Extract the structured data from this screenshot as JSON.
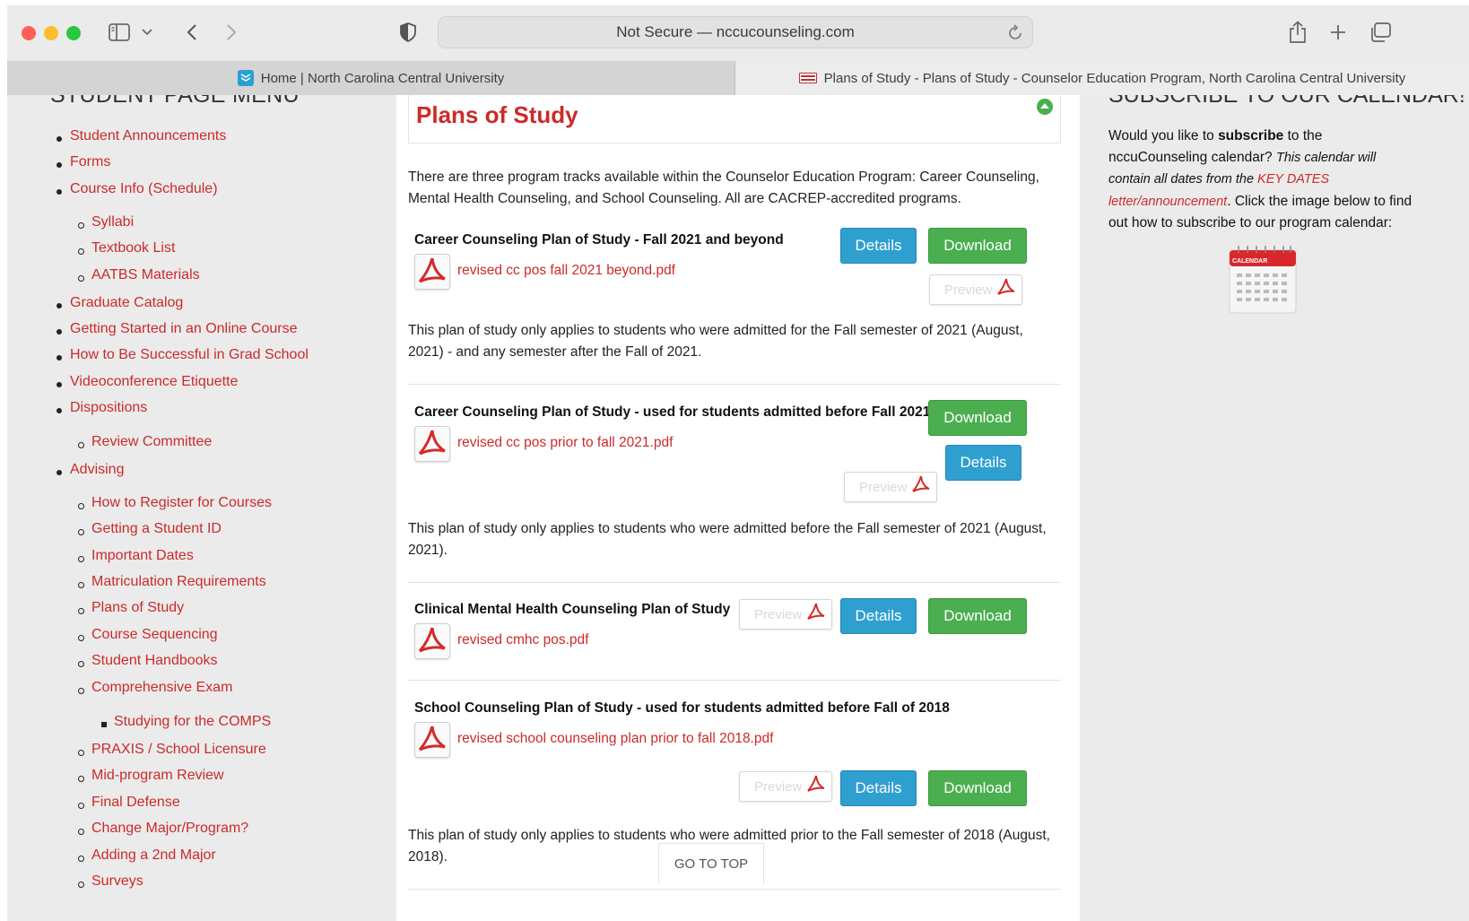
{
  "browser": {
    "address": "Not Secure — nccucounseling.com",
    "tabs": [
      {
        "label": "Home | North Carolina Central University"
      },
      {
        "label": "Plans of Study - Plans of Study - Counselor Education Program, North Carolina Central University"
      }
    ]
  },
  "sidebar": {
    "heading": "STUDENT PAGE MENU",
    "items": [
      {
        "label": "Student Announcements"
      },
      {
        "label": "Forms"
      },
      {
        "label": "Course Info (Schedule)"
      },
      {
        "label": "Syllabi"
      },
      {
        "label": "Textbook List"
      },
      {
        "label": "AATBS Materials"
      },
      {
        "label": "Graduate Catalog"
      },
      {
        "label": "Getting Started in an Online Course"
      },
      {
        "label": "How to Be Successful in Grad School"
      },
      {
        "label": "Videoconference Etiquette"
      },
      {
        "label": "Dispositions"
      },
      {
        "label": "Review Committee"
      },
      {
        "label": "Advising"
      },
      {
        "label": "How to Register for Courses"
      },
      {
        "label": "Getting a Student ID"
      },
      {
        "label": "Important Dates"
      },
      {
        "label": "Matriculation Requirements"
      },
      {
        "label": "Plans of Study"
      },
      {
        "label": "Course Sequencing"
      },
      {
        "label": "Student Handbooks"
      },
      {
        "label": "Comprehensive Exam"
      },
      {
        "label": "Studying for the COMPS"
      },
      {
        "label": "PRAXIS / School Licensure"
      },
      {
        "label": "Mid-program Review"
      },
      {
        "label": "Final Defense"
      },
      {
        "label": "Change Major/Program?"
      },
      {
        "label": "Adding a 2nd Major"
      },
      {
        "label": "Surveys"
      }
    ]
  },
  "main": {
    "title": "Plans of Study",
    "intro": "There are three program tracks available within the Counselor Education Program: Career Counseling, Mental Health Counseling, and School Counseling.  All are CACREP-accredited programs.",
    "buttons": {
      "details": "Details",
      "download": "Download",
      "preview": "Preview"
    },
    "plans": [
      {
        "title": "Career Counseling Plan of Study - Fall 2021 and beyond",
        "file": "revised cc pos fall 2021 beyond.pdf",
        "description": "This plan of study only applies to students who were admitted for the Fall semester of 2021 (August, 2021) - and any semester after the Fall of 2021."
      },
      {
        "title": "Career Counseling Plan of Study - used for students admitted before Fall 2021",
        "file": "revised cc pos prior to fall 2021.pdf",
        "description": "This plan of study only applies to students who were admitted before the Fall semester of 2021 (August, 2021)."
      },
      {
        "title": "Clinical Mental Health Counseling Plan of Study",
        "file": "revised cmhc pos.pdf",
        "description": ""
      },
      {
        "title": "School Counseling Plan of Study - used for students admitted before Fall of 2018",
        "file": "revised school counseling plan prior to fall 2018.pdf",
        "description": "This plan of study only applies to students who were admitted prior to the Fall semester of 2018 (August, 2018)."
      }
    ],
    "go_top": "GO TO TOP"
  },
  "right": {
    "heading": "SUBSCRIBE TO OUR CALENDAR!",
    "p1": "Would you like to ",
    "p1_bold": "subscribe",
    "p2": " to the nccuCounseling calendar?  ",
    "p2_italic": "This calendar will contain all dates from the ",
    "p2_link": "KEY DATES letter/announcement",
    "p3": ".  Click the image below to find out how to subscribe to our program calendar:",
    "calendar_label": "CALENDAR"
  }
}
